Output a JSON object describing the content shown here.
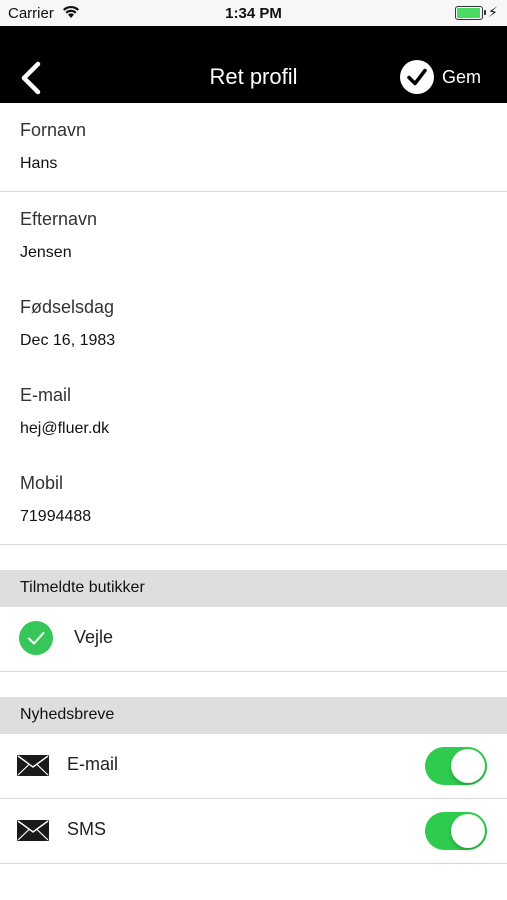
{
  "status_bar": {
    "carrier": "Carrier",
    "time": "1:34 PM",
    "battery_level": 1.0
  },
  "nav": {
    "title": "Ret profil",
    "save_label": "Gem",
    "back_icon": "chevron-left-icon",
    "save_icon": "checkmark-circle-icon"
  },
  "fields": [
    {
      "label": "Fornavn",
      "value": "Hans"
    },
    {
      "label": "Efternavn",
      "value": "Jensen"
    },
    {
      "label": "Fødselsdag",
      "value": "Dec 16, 1983"
    },
    {
      "label": "E-mail",
      "value": "hej@fluer.dk"
    },
    {
      "label": "Mobil",
      "value": "71994488"
    }
  ],
  "stores": {
    "header": "Tilmeldte butikker",
    "items": [
      {
        "name": "Vejle",
        "selected": true
      }
    ]
  },
  "newsletters": {
    "header": "Nyhedsbreve",
    "items": [
      {
        "label": "E-mail",
        "icon": "envelope-icon",
        "enabled": true
      },
      {
        "label": "SMS",
        "icon": "envelope-icon",
        "enabled": true
      }
    ]
  },
  "colors": {
    "nav_bg": "#000000",
    "toggle_on": "#2fcb4f",
    "check_green": "#36c659",
    "section_bg": "#dedede"
  }
}
